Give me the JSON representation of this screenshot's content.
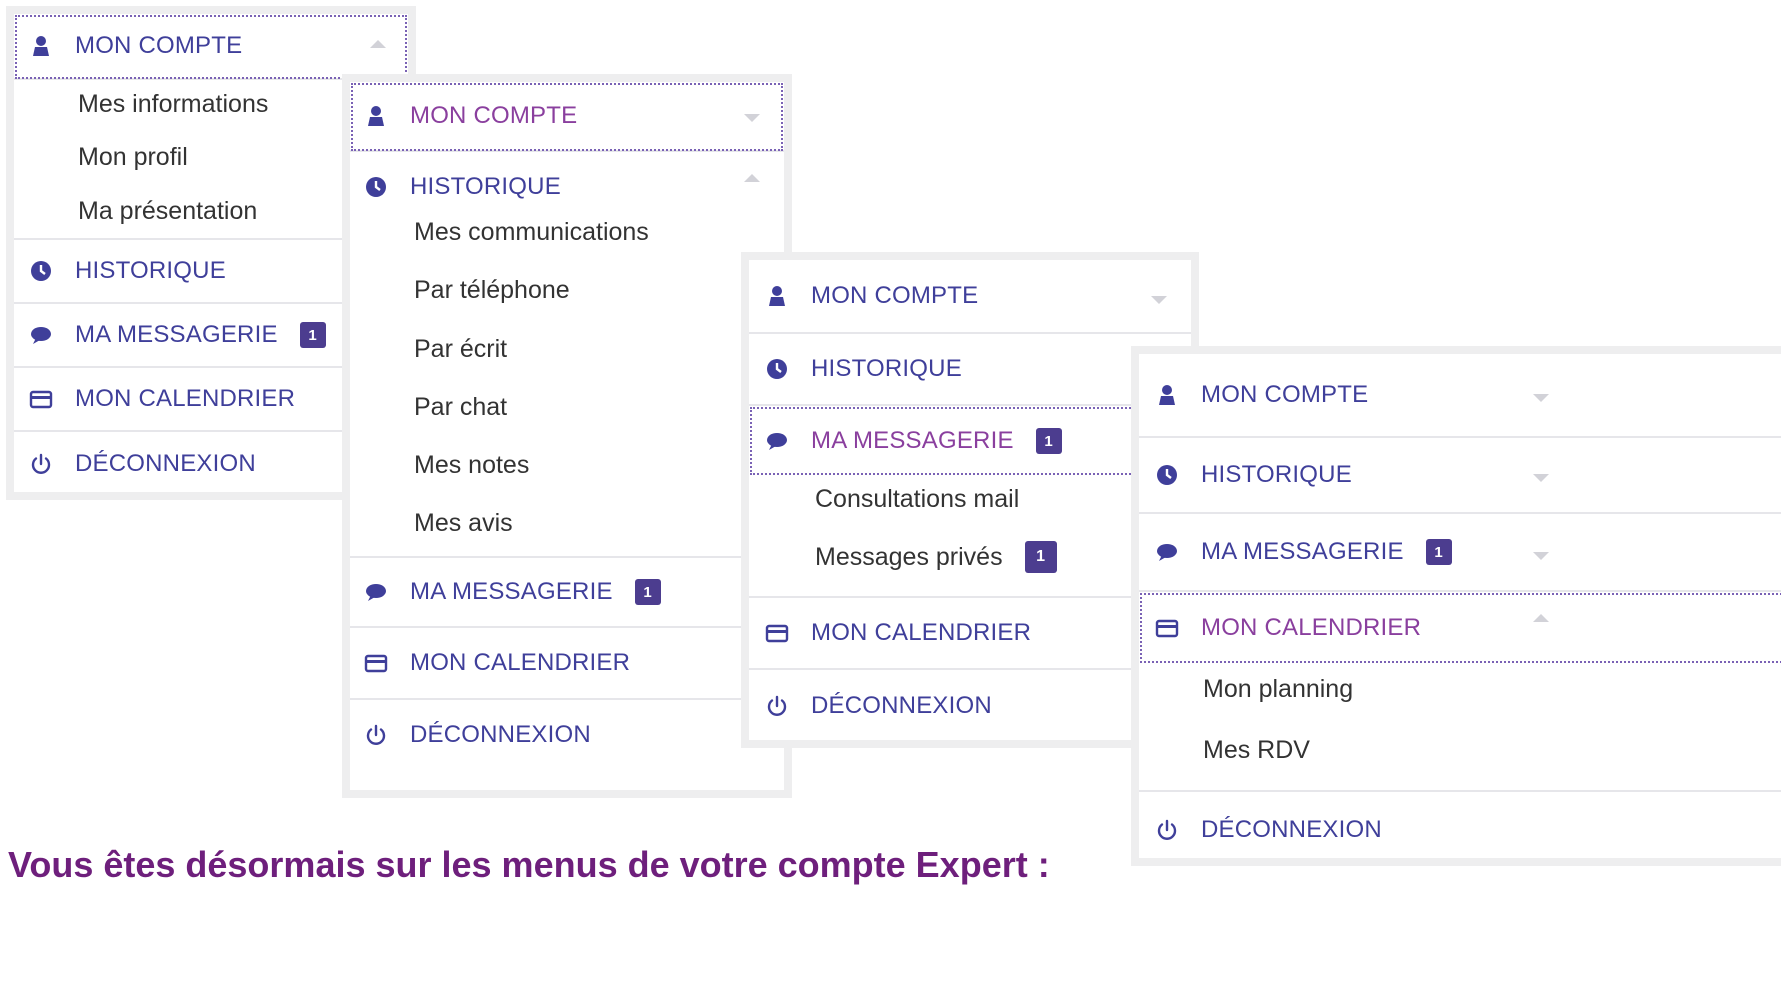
{
  "caption": "Vous êtes désormais sur les menus de votre compte Expert :",
  "menu1": {
    "compte": "MON COMPTE",
    "compte_items": [
      "Mes informations",
      "Mon profil",
      "Ma présentation"
    ],
    "historique": "HISTORIQUE",
    "messagerie": "MA MESSAGERIE",
    "messagerie_badge": "1",
    "calendrier": "MON CALENDRIER",
    "deconnexion": "DÉCONNEXION"
  },
  "menu2": {
    "compte": "MON COMPTE",
    "historique": "HISTORIQUE",
    "historique_items": [
      "Mes communications",
      "Par téléphone",
      "Par écrit",
      "Par chat",
      "Mes notes",
      "Mes avis"
    ],
    "messagerie": "MA MESSAGERIE",
    "messagerie_badge": "1",
    "calendrier": "MON CALENDRIER",
    "deconnexion": "DÉCONNEXION"
  },
  "menu3": {
    "compte": "MON COMPTE",
    "historique": "HISTORIQUE",
    "messagerie": "MA MESSAGERIE",
    "messagerie_badge": "1",
    "messagerie_items": [
      "Consultations mail",
      "Messages privés"
    ],
    "messages_prives_badge": "1",
    "calendrier": "MON CALENDRIER",
    "deconnexion": "DÉCONNEXION"
  },
  "menu4": {
    "compte": "MON COMPTE",
    "historique": "HISTORIQUE",
    "messagerie": "MA MESSAGERIE",
    "messagerie_badge": "1",
    "calendrier": "MON CALENDRIER",
    "calendrier_items": [
      "Mon planning",
      "Mes RDV"
    ],
    "deconnexion": "DÉCONNEXION"
  },
  "colors": {
    "menu_text": "#3f3f9a",
    "active_text": "#8a3f9e",
    "badge": "#4c3d8f",
    "caption": "#6e1f7c"
  },
  "icons": [
    "user-icon",
    "clock-icon",
    "chat-bubble-icon",
    "calendar-icon",
    "power-icon"
  ]
}
